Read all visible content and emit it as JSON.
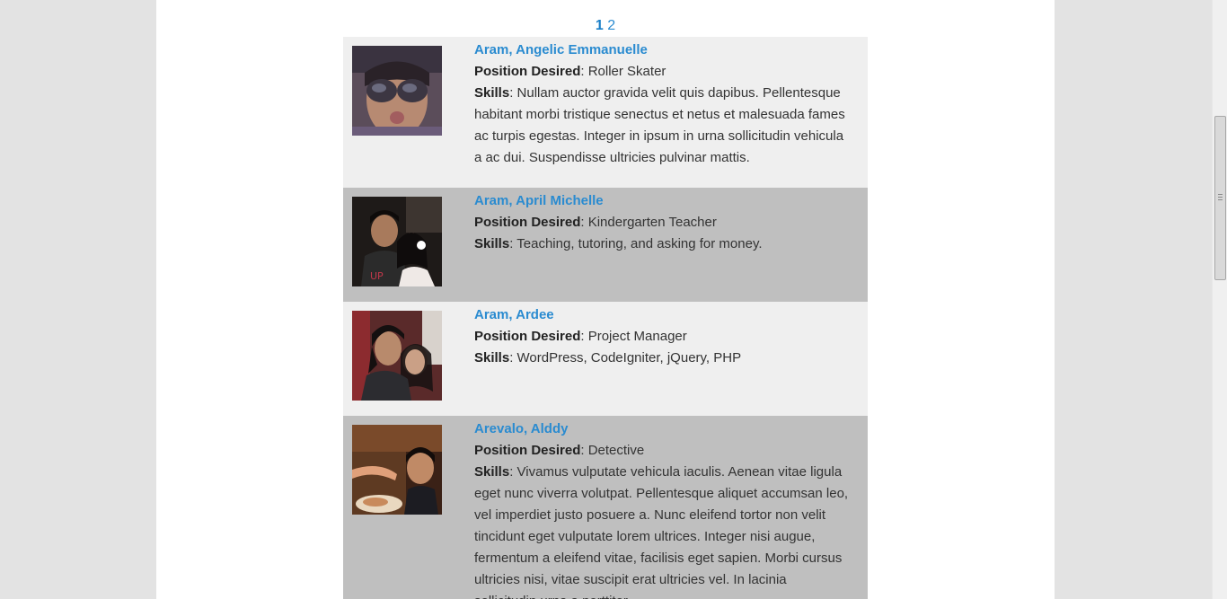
{
  "pagination": {
    "pages": [
      "1",
      "2"
    ],
    "current": "1"
  },
  "labels": {
    "position": "Position Desired",
    "skills": "Skills"
  },
  "applicants": [
    {
      "name": "Aram, Angelic Emmanuelle",
      "position": "Roller Skater",
      "skills": "Nullam auctor gravida velit quis dapibus. Pellentesque habitant morbi tristique senectus et netus et malesuada fames ac turpis egestas. Integer in ipsum in urna sollicitudin vehicula a ac dui. Suspendisse ultricies pulvinar mattis."
    },
    {
      "name": "Aram, April Michelle",
      "position": "Kindergarten Teacher",
      "skills": "Teaching, tutoring, and asking for money."
    },
    {
      "name": "Aram, Ardee",
      "position": "Project Manager",
      "skills": "WordPress, CodeIgniter, jQuery, PHP"
    },
    {
      "name": "Arevalo, Alddy",
      "position": "Detective",
      "skills": "Vivamus vulputate vehicula iaculis. Aenean vitae ligula eget nunc viverra volutpat. Pellentesque aliquet accumsan leo, vel imperdiet justo posuere a. Nunc eleifend tortor non velit tincidunt eget vulputate lorem ultrices. Integer nisi augue, fermentum a eleifend vitae, facilisis eget sapien. Morbi cursus ultricies nisi, vitae suscipit erat ultricies vel. In lacinia sollicitudin urna a porttitor."
    }
  ],
  "colors": {
    "link": "#2a8bd0",
    "row_light": "#efefef",
    "row_dark": "#bfbfbf",
    "page_bg": "#e3e3e3"
  }
}
